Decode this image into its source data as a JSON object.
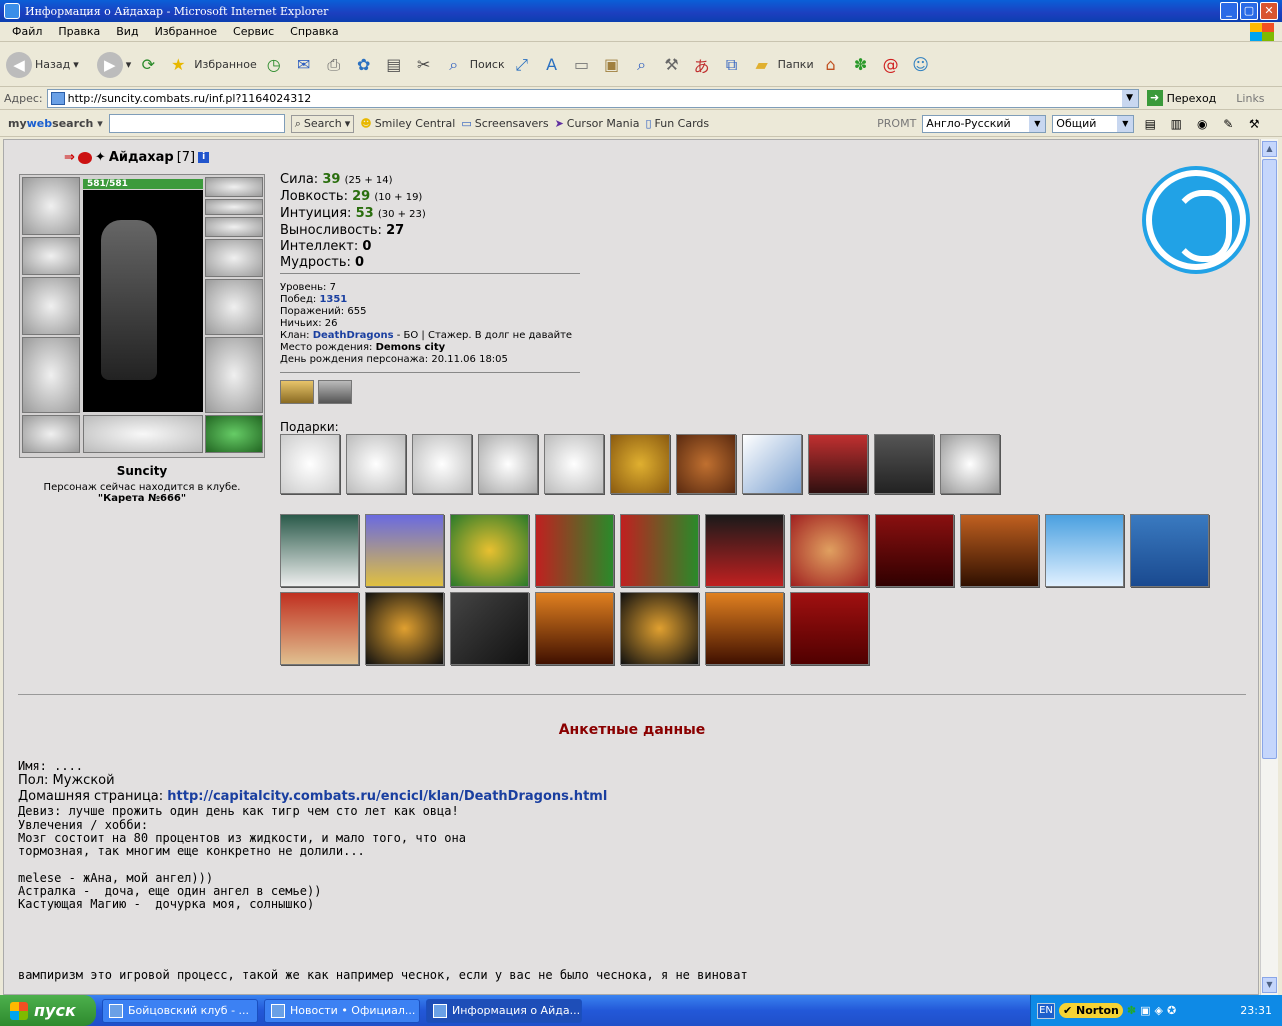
{
  "window": {
    "title": "Информация о Айдахар - Microsoft Internet Explorer"
  },
  "menu": [
    "Файл",
    "Правка",
    "Вид",
    "Избранное",
    "Сервис",
    "Справка"
  ],
  "toolbar": {
    "back": "Назад",
    "favorites": "Избранное",
    "search": "Поиск",
    "folders": "Папки"
  },
  "address": {
    "label": "Адрес:",
    "url": "http://suncity.combats.ru/inf.pl?1164024312",
    "go": "Переход",
    "links": "Links"
  },
  "searchbar": {
    "brand_my": "my",
    "brand_web": "web",
    "brand_search": "search",
    "search_btn": "Search",
    "smiley": "Smiley Central",
    "screensavers": "Screensavers",
    "cursor": "Cursor Mania",
    "funcards": "Fun Cards",
    "promt": "PROMT",
    "lang": "Англо-Русский",
    "topic": "Общий"
  },
  "character": {
    "name": "Айдахар",
    "level": "[7]",
    "hp": "581/581",
    "city": "Suncity",
    "location_text": "Персонаж сейчас находится в клубе.",
    "location": "\"Карета №666\""
  },
  "stats": [
    {
      "label": "Сила:",
      "value": "39",
      "detail": "(25 + 14)"
    },
    {
      "label": "Ловкость:",
      "value": "29",
      "detail": "(10 + 19)"
    },
    {
      "label": "Интуиция:",
      "value": "53",
      "detail": "(30 + 23)"
    },
    {
      "label": "Выносливость:",
      "value": "27",
      "detail": ""
    },
    {
      "label": "Интеллект:",
      "value": "0",
      "detail": ""
    },
    {
      "label": "Мудрость:",
      "value": "0",
      "detail": ""
    }
  ],
  "info": {
    "level_label": "Уровень:",
    "level": "7",
    "wins_label": "Побед:",
    "wins": "1351",
    "losses_label": "Поражений:",
    "losses": "655",
    "draws_label": "Ничьих:",
    "draws": "26",
    "clan_label": "Клан:",
    "clan": "DeathDragons",
    "clan_note": " - БО | Стажер. В долг не давайте",
    "birth_place_label": "Место рождения:",
    "birth_place": "Demons city",
    "birthday_label": "День рождения персонажа:",
    "birthday": "20.11.06 18:05"
  },
  "gifts_label": "Подарки:",
  "profile": {
    "title": "Анкетные данные",
    "name_line": "Имя: ....",
    "gender_line": "Пол: Мужской",
    "homepage_label": "Домашняя страница: ",
    "homepage": "http://capitalcity.combats.ru/encicl/klan/DeathDragons.html",
    "motto_line": "Девиз: лучше прожить один день как тигр чем сто лет как овца!",
    "hobby_line": "Увлечения / хобби:",
    "hobby_text": "Мозг состоит на 80 процентов из жидкости, и мало того, что она\nтормозная, так многим еще конкретно не долили...\n\nmelese - жАна, мой ангел)))\nАстралка -  доча, еще один ангел в семье))\nКастующая Магию -  дочурка моя, солнышко)",
    "bottom": "вампиризм это игровой процесс, такой же как например чеснок, если у вас не было чеснока, я не виноват"
  },
  "taskbar": {
    "start": "пуск",
    "tasks": [
      "Бойцовский клуб - ...",
      "Новости • Официал...",
      "Информация о Айда..."
    ],
    "lang": "EN",
    "norton": "Norton",
    "clock": "23:31"
  },
  "colors": {
    "stat_green": "#2a6e0e",
    "link_blue": "#1a3fa0",
    "profile_title": "#8a0000",
    "content_bg": "#e2e0e0"
  }
}
